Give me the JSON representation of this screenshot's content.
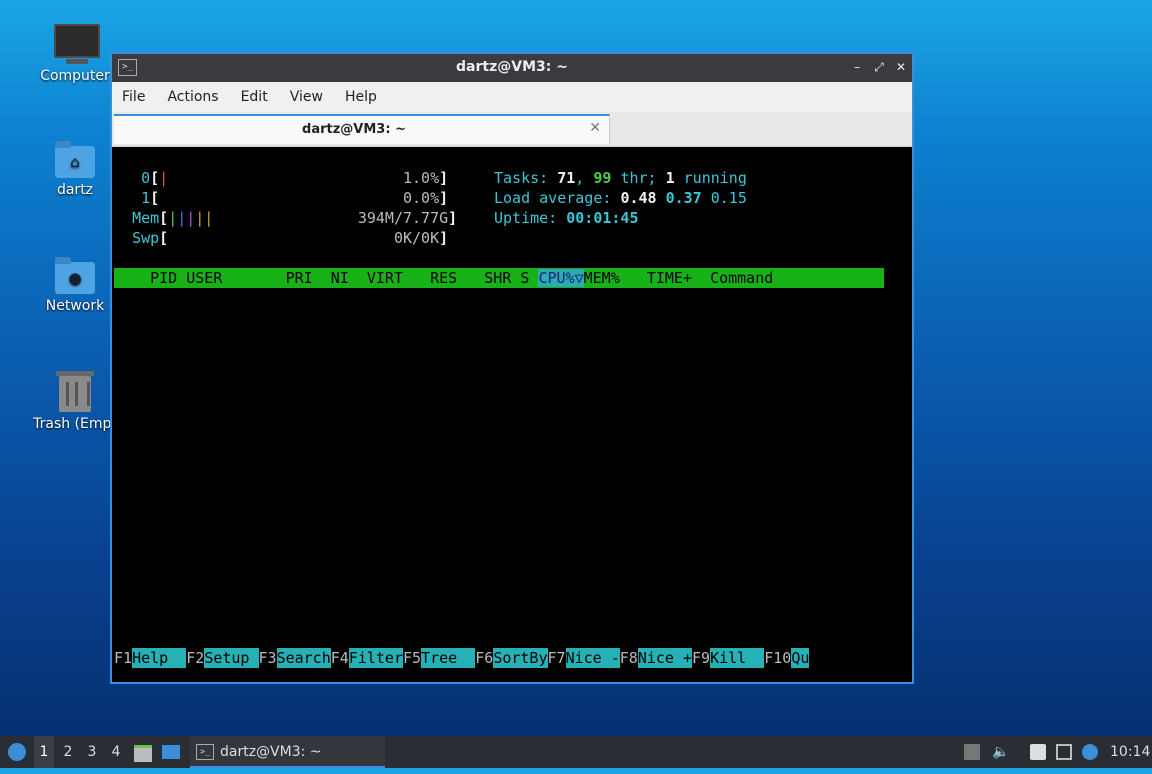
{
  "desktop": {
    "icons": [
      {
        "label": "Computer",
        "icon": "computer-icon"
      },
      {
        "label": "dartz",
        "icon": "home-folder-icon"
      },
      {
        "label": "Network",
        "icon": "network-folder-icon"
      },
      {
        "label": "Trash (Empt",
        "icon": "trash-icon"
      }
    ]
  },
  "window": {
    "title": "dartz@VM3: ~",
    "controls": {
      "minimize": "–",
      "maximize": "⤢",
      "close": "✕"
    },
    "menu": [
      "File",
      "Actions",
      "Edit",
      "View",
      "Help"
    ],
    "tab": {
      "title": "dartz@VM3: ~",
      "close": "✕"
    }
  },
  "htop": {
    "cpu0": {
      "label": "0",
      "value": "1.0%"
    },
    "cpu1": {
      "label": "1",
      "value": "0.0%"
    },
    "mem": {
      "label": "Mem",
      "value": "394M/7.77G"
    },
    "swp": {
      "label": "Swp",
      "value": "0K/0K"
    },
    "tasks": {
      "label": "Tasks:",
      "count": "71",
      "sep": ",",
      "threads": "99",
      "thr_label": "thr;",
      "running": "1",
      "running_label": "running"
    },
    "load": {
      "label": "Load average:",
      "l1": "0.48",
      "l5": "0.37",
      "l15": "0.15"
    },
    "uptime": {
      "label": "Uptime:",
      "value": "00:01:45"
    },
    "columns": {
      "pid": "PID",
      "user": "USER",
      "pri": "PRI",
      "ni": "NI",
      "virt": "VIRT",
      "res": "RES",
      "shr": "SHR",
      "s": "S",
      "cpu": "CPU%▽",
      "mem": "MEM%",
      "time": "TIME+",
      "command": "Command"
    },
    "fkeys": [
      {
        "key": "F1",
        "label": "Help  "
      },
      {
        "key": "F2",
        "label": "Setup "
      },
      {
        "key": "F3",
        "label": "Search"
      },
      {
        "key": "F4",
        "label": "Filter"
      },
      {
        "key": "F5",
        "label": "Tree  "
      },
      {
        "key": "F6",
        "label": "SortBy"
      },
      {
        "key": "F7",
        "label": "Nice -"
      },
      {
        "key": "F8",
        "label": "Nice +"
      },
      {
        "key": "F9",
        "label": "Kill  "
      },
      {
        "key": "F10",
        "label": "Qu"
      }
    ]
  },
  "taskbar": {
    "workspaces": [
      "1",
      "2",
      "3",
      "4"
    ],
    "active_workspace": "1",
    "task_title": "dartz@VM3: ~",
    "clock": "10:14"
  }
}
